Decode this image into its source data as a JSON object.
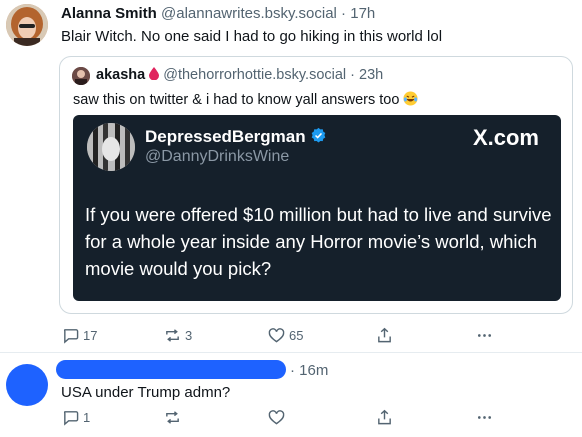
{
  "post1": {
    "name": "Alanna Smith",
    "handle": "@alannawrites.bsky.social",
    "separator": " · ",
    "time": "17h",
    "text": "Blair Witch. No one said I had to go hiking in this world lol",
    "quote": {
      "name": "akasha",
      "emoji": "drop-icon",
      "handle": "@thehorrorhottie.bsky.social",
      "separator": " · ",
      "time": "23h",
      "text": "saw this on twitter & i had to know yall answers too",
      "card": {
        "name": "DepressedBergman",
        "handle": "@DannyDrinksWine",
        "brand": "X.com",
        "body": "If you were offered $10 million but had to live and survive for a whole year inside any Horror movie’s world, which movie would you pick?"
      }
    },
    "actions": {
      "replies": "17",
      "reposts": "3",
      "likes": "65"
    }
  },
  "post2": {
    "time": "· 16m",
    "text": "USA under Trump admn?",
    "actions": {
      "replies": "1",
      "reposts": "",
      "likes": ""
    }
  },
  "colors": {
    "accent": "#0085ff",
    "verified": "#1d9bf0",
    "redaction": "#1e62ff",
    "card_bg": "#15202b"
  }
}
